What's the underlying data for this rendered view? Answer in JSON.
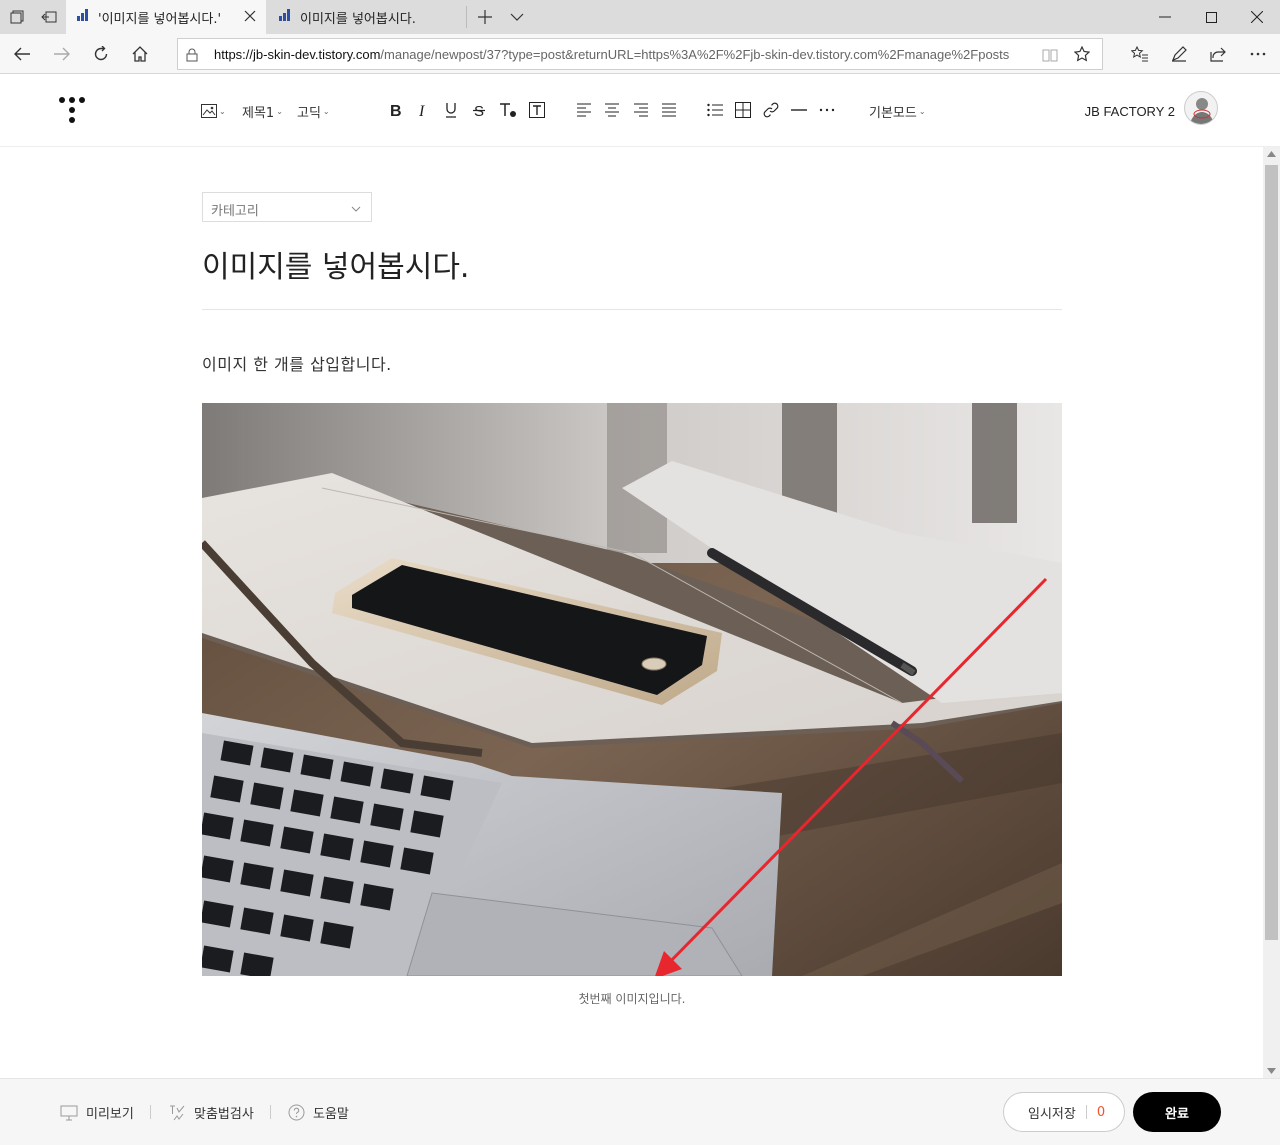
{
  "browser": {
    "tabs": [
      {
        "label": "'이미지를 넣어봅시다.'",
        "active": true
      },
      {
        "label": "이미지를 넣어봅시다.",
        "active": false
      }
    ],
    "url_host": "https://jb-skin-dev.tistory.com",
    "url_path": "/manage/newpost/37?type=post&returnURL=https%3A%2F%2Fjb-skin-dev.tistory.com%2Fmanage%2Fposts"
  },
  "toolbar": {
    "heading": "제목1",
    "font": "고딕",
    "mode": "기본모드",
    "blog_name": "JB FACTORY 2"
  },
  "post": {
    "category_placeholder": "카테고리",
    "title": "이미지를 넣어봅시다.",
    "body": "이미지 한 개를 삽입합니다.",
    "caption": "첫번째 이미지입니다."
  },
  "footer": {
    "preview": "미리보기",
    "spellcheck": "맞춤법검사",
    "help": "도움말",
    "temp_save": "임시저장",
    "temp_count": "0",
    "done": "완료"
  },
  "colors": {
    "annotation_arrow": "#e8262e",
    "temp_count": "#f0522b",
    "done_button": "#000000"
  }
}
